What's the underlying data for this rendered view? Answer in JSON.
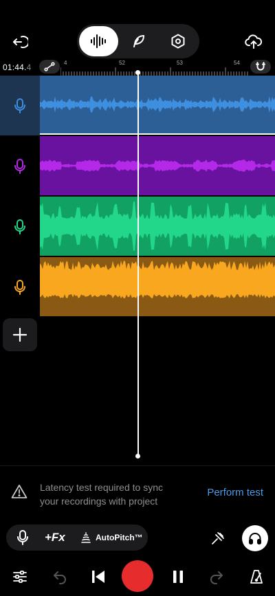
{
  "header": {
    "back_icon": "exit-icon",
    "modes": [
      {
        "name": "waveform",
        "icon": "waveform-icon",
        "active": true
      },
      {
        "name": "lyrics",
        "icon": "feather-icon",
        "active": false
      },
      {
        "name": "settings",
        "icon": "hexagon-settings-icon",
        "active": false
      }
    ],
    "upload_icon": "cloud-upload-icon"
  },
  "timeline": {
    "time_main": "01:44.",
    "time_frac": "4",
    "ruler_labels": [
      "4",
      "52",
      "53",
      "54"
    ],
    "snap_icon": "magnet-icon",
    "automation_icon": "automation-curve-icon"
  },
  "tracks": [
    {
      "color": "#3f8fe0",
      "clip_bg": "#2d5f97",
      "icon": "microphone-icon",
      "selected": true
    },
    {
      "color": "#b428e8",
      "clip_bg": "#6a12a0",
      "icon": "microphone-icon",
      "selected": false
    },
    {
      "color": "#22d68a",
      "clip_bg": "#10a163",
      "icon": "microphone-icon",
      "selected": false
    },
    {
      "color": "#f8a71e",
      "clip_bg": "#8a5a14",
      "icon": "microphone-icon",
      "selected": false
    }
  ],
  "latency": {
    "message": "Latency test required to sync your recordings with project",
    "action": "Perform test"
  },
  "tools": {
    "fx_label": "+Fx",
    "autopitch_label": "AutoPitch™"
  },
  "colors": {
    "record": "#e62c2c",
    "accent": "#4b9be8"
  }
}
